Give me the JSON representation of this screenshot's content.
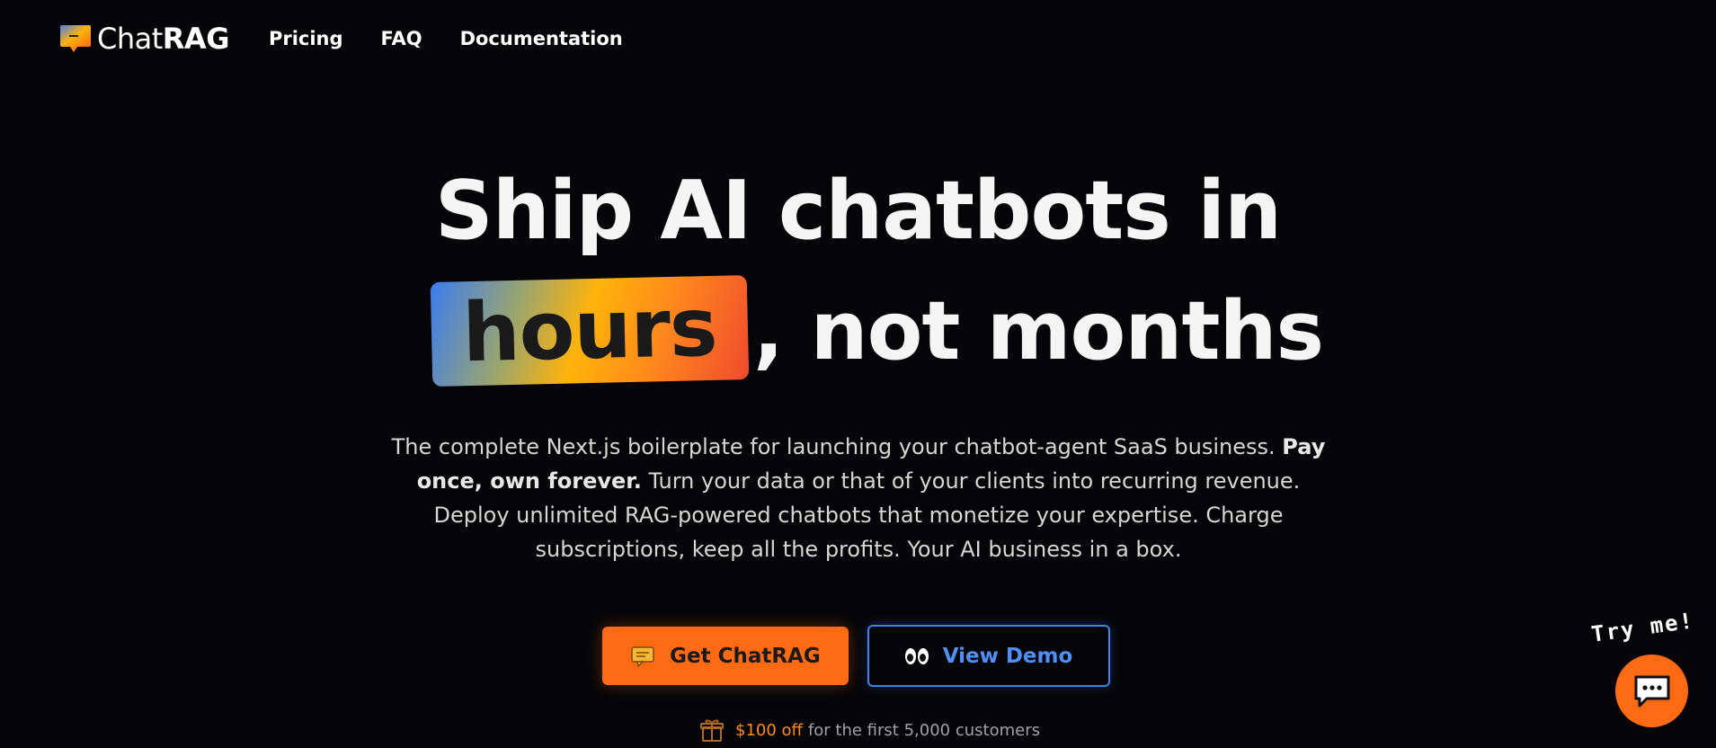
{
  "header": {
    "logo_regular": "Chat",
    "logo_bold": "RAG",
    "nav": [
      {
        "label": "Pricing"
      },
      {
        "label": "FAQ"
      },
      {
        "label": "Documentation"
      }
    ]
  },
  "hero": {
    "line1": "Ship AI chatbots in",
    "highlight": "hours",
    "line2_rest": ", not months",
    "description_part1": "The complete Next.js boilerplate for launching your chatbot-agent SaaS business.",
    "description_bold": "Pay once, own forever.",
    "description_part2": "Turn your data or that of your clients into recurring revenue. Deploy unlimited RAG-powered chatbots that monetize your expertise. Charge subscriptions, keep all the profits. Your AI business in a box."
  },
  "cta": {
    "primary_label": "Get ChatRAG",
    "secondary_label": "View Demo"
  },
  "discount": {
    "amount": "$100 off",
    "text": "for the first 5,000 customers"
  },
  "chat_widget": {
    "prompt": "Try me!"
  },
  "colors": {
    "accent_orange": "#ff6a13",
    "accent_blue": "#3b82f6",
    "background": "#050508"
  },
  "icons": {
    "logo": "chat-bubble-logo-icon",
    "primary_button": "message-icon",
    "secondary_button": "eyes-icon",
    "discount": "gift-icon",
    "chat_widget": "chat-dots-icon"
  }
}
